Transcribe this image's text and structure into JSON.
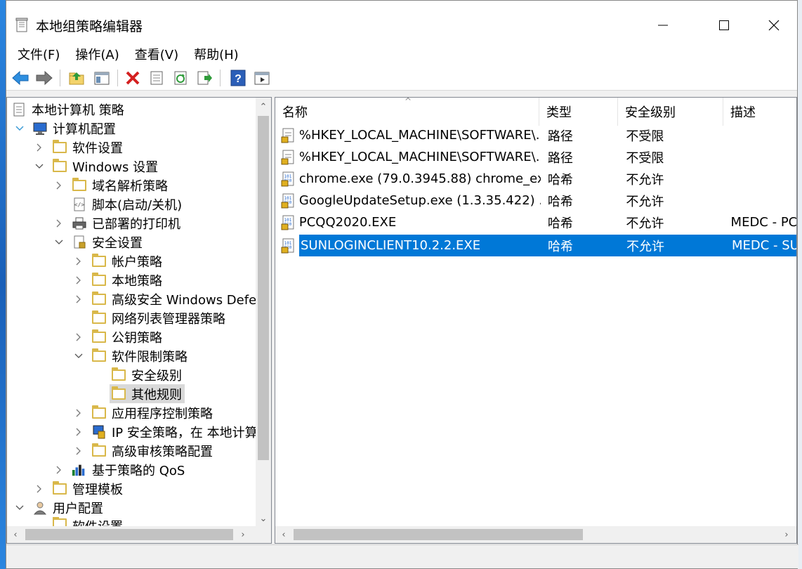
{
  "window": {
    "title": "本地组策略编辑器"
  },
  "menu": [
    "文件(F)",
    "操作(A)",
    "查看(V)",
    "帮助(H)"
  ],
  "toolbar": [
    "back-icon",
    "forward-icon",
    "up-folder-icon",
    "show-hide-tree-icon",
    "delete-icon",
    "properties-icon",
    "refresh-icon",
    "export-list-icon",
    "help-icon",
    "action-pane-icon"
  ],
  "tree": {
    "root": "本地计算机 策略",
    "computer_config": "计算机配置",
    "software_settings": "软件设置",
    "windows_settings": "Windows 设置",
    "dns_policy": "域名解析策略",
    "scripts": "脚本(启动/关机)",
    "printers": "已部署的打印机",
    "security_settings": "安全设置",
    "account_policy": "帐户策略",
    "local_policy": "本地策略",
    "firewall": "高级安全 Windows Defe",
    "network_list": "网络列表管理器策略",
    "public_key": "公钥策略",
    "srp": "软件限制策略",
    "security_levels": "安全级别",
    "other_rules": "其他规则",
    "app_control": "应用程序控制策略",
    "ipsec": "IP 安全策略，在 本地计算",
    "audit": "高级审核策略配置",
    "qos": "基于策略的 QoS",
    "admin_templates": "管理模板",
    "user_config": "用户配置",
    "user_software": "软件设置"
  },
  "list": {
    "headers": {
      "name": "名称",
      "type": "类型",
      "level": "安全级别",
      "desc": "描述"
    },
    "rows": [
      {
        "name": "%HKEY_LOCAL_MACHINE\\SOFTWARE\\...",
        "type": "路径",
        "level": "不受限",
        "desc": ""
      },
      {
        "name": "%HKEY_LOCAL_MACHINE\\SOFTWARE\\...",
        "type": "路径",
        "level": "不受限",
        "desc": ""
      },
      {
        "name": "chrome.exe (79.0.3945.88)  chrome_ex...",
        "type": "哈希",
        "level": "不允许",
        "desc": ""
      },
      {
        "name": "GoogleUpdateSetup.exe (1.3.35.422)  ...",
        "type": "哈希",
        "level": "不允许",
        "desc": ""
      },
      {
        "name": "PCQQ2020.EXE",
        "type": "哈希",
        "level": "不允许",
        "desc": "MEDC - PCQ"
      },
      {
        "name": "SUNLOGINCLIENT10.2.2.EXE",
        "type": "哈希",
        "level": "不允许",
        "desc": "MEDC - SU"
      }
    ]
  }
}
